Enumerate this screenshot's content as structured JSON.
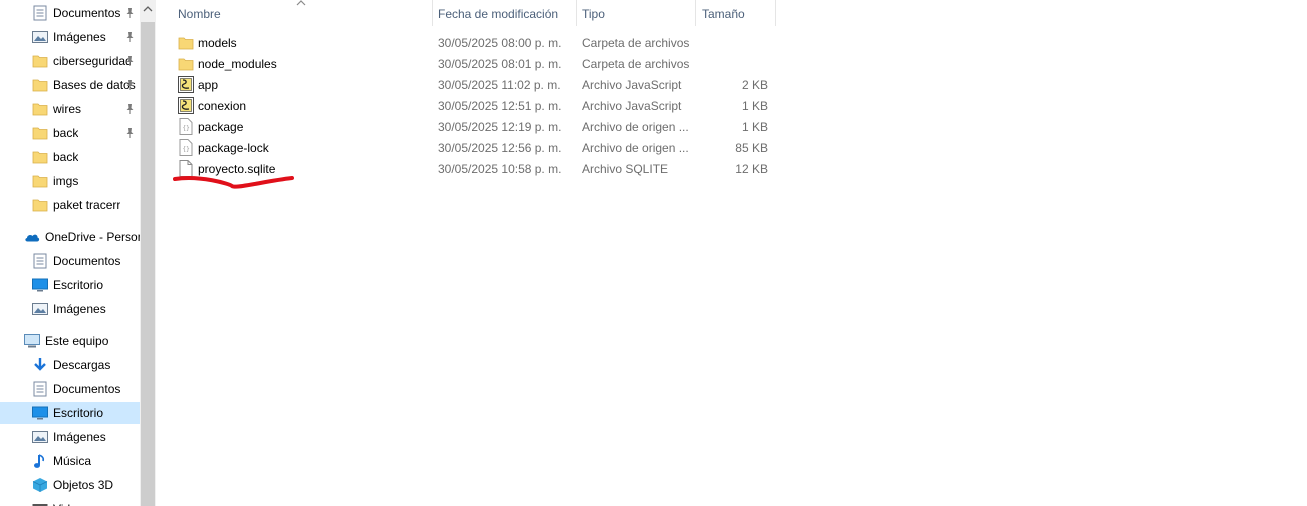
{
  "nav": {
    "quick_access": [
      {
        "label": "Documentos",
        "icon": "documents-icon",
        "pinned": true
      },
      {
        "label": "Imágenes",
        "icon": "pictures-icon",
        "pinned": true
      },
      {
        "label": "ciberseguridad",
        "icon": "folder-icon",
        "pinned": true
      },
      {
        "label": "Bases de datos",
        "icon": "folder-icon",
        "pinned": true
      },
      {
        "label": "wires",
        "icon": "folder-icon",
        "pinned": true
      },
      {
        "label": "back",
        "icon": "folder-icon",
        "pinned": true
      },
      {
        "label": "back",
        "icon": "folder-icon",
        "pinned": false
      },
      {
        "label": "imgs",
        "icon": "folder-icon",
        "pinned": false
      },
      {
        "label": "paket tracerr",
        "icon": "folder-icon",
        "pinned": false
      }
    ],
    "onedrive": {
      "label": "OneDrive - Personal",
      "items": [
        {
          "label": "Documentos",
          "icon": "documents-icon"
        },
        {
          "label": "Escritorio",
          "icon": "desktop-icon"
        },
        {
          "label": "Imágenes",
          "icon": "pictures-icon"
        }
      ]
    },
    "this_pc": {
      "label": "Este equipo",
      "items": [
        {
          "label": "Descargas",
          "icon": "downloads-icon"
        },
        {
          "label": "Documentos",
          "icon": "documents-icon"
        },
        {
          "label": "Escritorio",
          "icon": "desktop-icon",
          "selected": true
        },
        {
          "label": "Imágenes",
          "icon": "pictures-icon"
        },
        {
          "label": "Música",
          "icon": "music-icon"
        },
        {
          "label": "Objetos 3D",
          "icon": "objects-3d-icon"
        },
        {
          "label": "Videos",
          "icon": "videos-icon"
        }
      ]
    }
  },
  "columns": {
    "name": "Nombre",
    "date": "Fecha de modificación",
    "type": "Tipo",
    "size": "Tamaño"
  },
  "files": [
    {
      "name": "models",
      "date": "30/05/2025 08:00 p. m.",
      "type": "Carpeta de archivos",
      "size": "",
      "icon": "folder-icon"
    },
    {
      "name": "node_modules",
      "date": "30/05/2025 08:01 p. m.",
      "type": "Carpeta de archivos",
      "size": "",
      "icon": "folder-icon"
    },
    {
      "name": "app",
      "date": "30/05/2025 11:02 p. m.",
      "type": "Archivo JavaScript",
      "size": "2 KB",
      "icon": "javascript-file-icon"
    },
    {
      "name": "conexion",
      "date": "30/05/2025 12:51 p. m.",
      "type": "Archivo JavaScript",
      "size": "1 KB",
      "icon": "javascript-file-icon"
    },
    {
      "name": "package",
      "date": "30/05/2025 12:19 p. m.",
      "type": "Archivo de origen ...",
      "size": "1 KB",
      "icon": "json-file-icon"
    },
    {
      "name": "package-lock",
      "date": "30/05/2025 12:56 p. m.",
      "type": "Archivo de origen ...",
      "size": "85 KB",
      "icon": "json-file-icon"
    },
    {
      "name": "proyecto.sqlite",
      "date": "30/05/2025 10:58 p. m.",
      "type": "Archivo SQLITE",
      "size": "12 KB",
      "icon": "blank-file-icon"
    }
  ],
  "colors": {
    "selected_bg": "#cce8ff",
    "header_text": "#4c607a",
    "annotation": "#e0101a",
    "folder": "#f8d775"
  }
}
